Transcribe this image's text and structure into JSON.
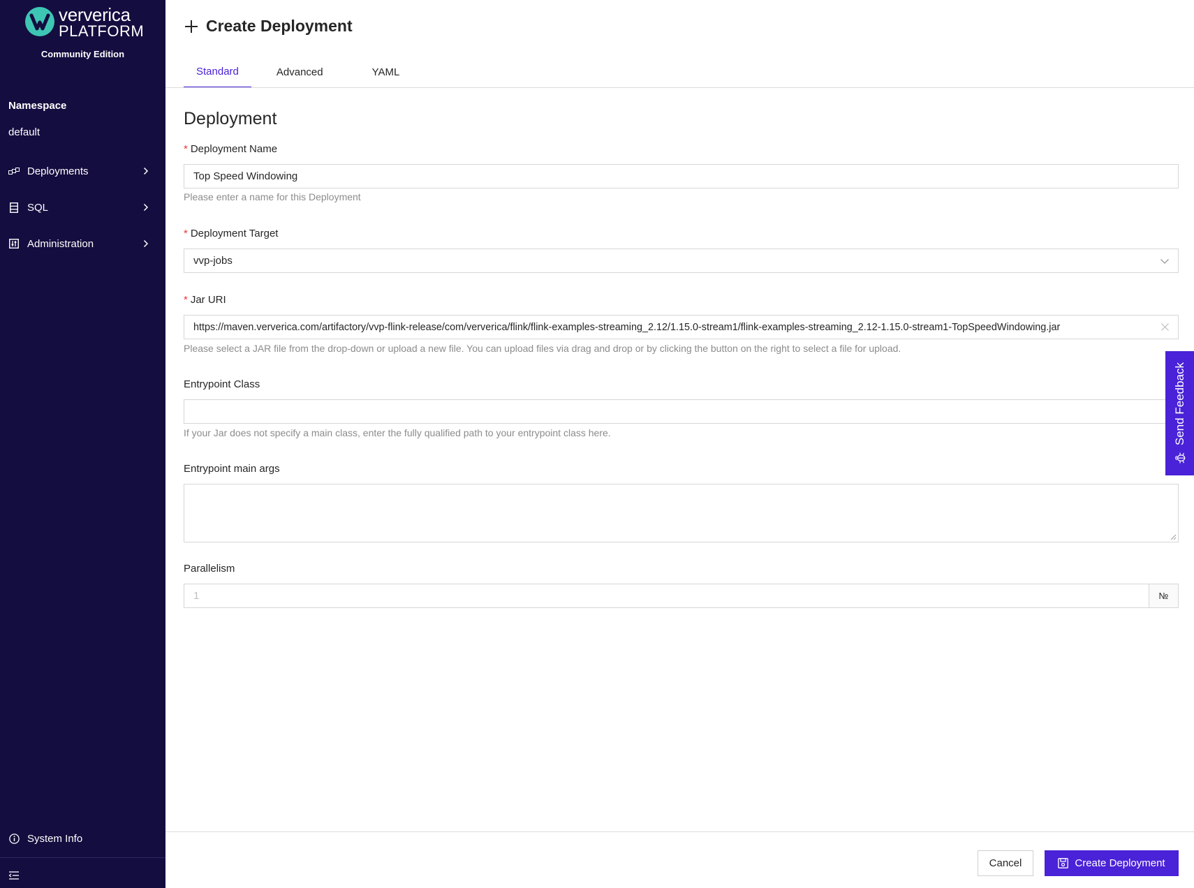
{
  "brand": {
    "name": "ververica",
    "product": "PLATFORM",
    "edition": "Community Edition",
    "accent_color": "#4a22d7",
    "logo_color": "#3ec6b4",
    "sidebar_color": "#140d3f"
  },
  "sidebar": {
    "namespace_label": "Namespace",
    "namespace_value": "default",
    "items": [
      {
        "label": "Deployments",
        "icon": "deployments-icon"
      },
      {
        "label": "SQL",
        "icon": "sql-icon"
      },
      {
        "label": "Administration",
        "icon": "administration-icon"
      }
    ],
    "system_info_label": "System Info"
  },
  "header": {
    "title": "Create Deployment"
  },
  "tabs": [
    {
      "label": "Standard",
      "active": true
    },
    {
      "label": "Advanced",
      "active": false
    },
    {
      "label": "YAML",
      "active": false
    }
  ],
  "form": {
    "section_title": "Deployment",
    "deployment_name": {
      "label": "Deployment Name",
      "required": true,
      "value": "Top Speed Windowing",
      "help": "Please enter a name for this Deployment"
    },
    "deployment_target": {
      "label": "Deployment Target",
      "required": true,
      "value": "vvp-jobs"
    },
    "jar_uri": {
      "label": "Jar URI",
      "required": true,
      "value": "https://maven.ververica.com/artifactory/vvp-flink-release/com/ververica/flink/flink-examples-streaming_2.12/1.15.0-stream1/flink-examples-streaming_2.12-1.15.0-stream1-TopSpeedWindowing.jar",
      "help": "Please select a JAR file from the drop-down or upload a new file. You can upload files via drag and drop or by clicking the button on the right to select a file for upload."
    },
    "entrypoint_class": {
      "label": "Entrypoint Class",
      "value": "",
      "help": "If your Jar does not specify a main class, enter the fully qualified path to your entrypoint class here."
    },
    "entrypoint_args": {
      "label": "Entrypoint main args",
      "value": ""
    },
    "parallelism": {
      "label": "Parallelism",
      "placeholder": "1",
      "suffix": "№"
    }
  },
  "footer": {
    "cancel_label": "Cancel",
    "submit_label": "Create Deployment"
  },
  "feedback": {
    "label": "Send Feedback"
  }
}
